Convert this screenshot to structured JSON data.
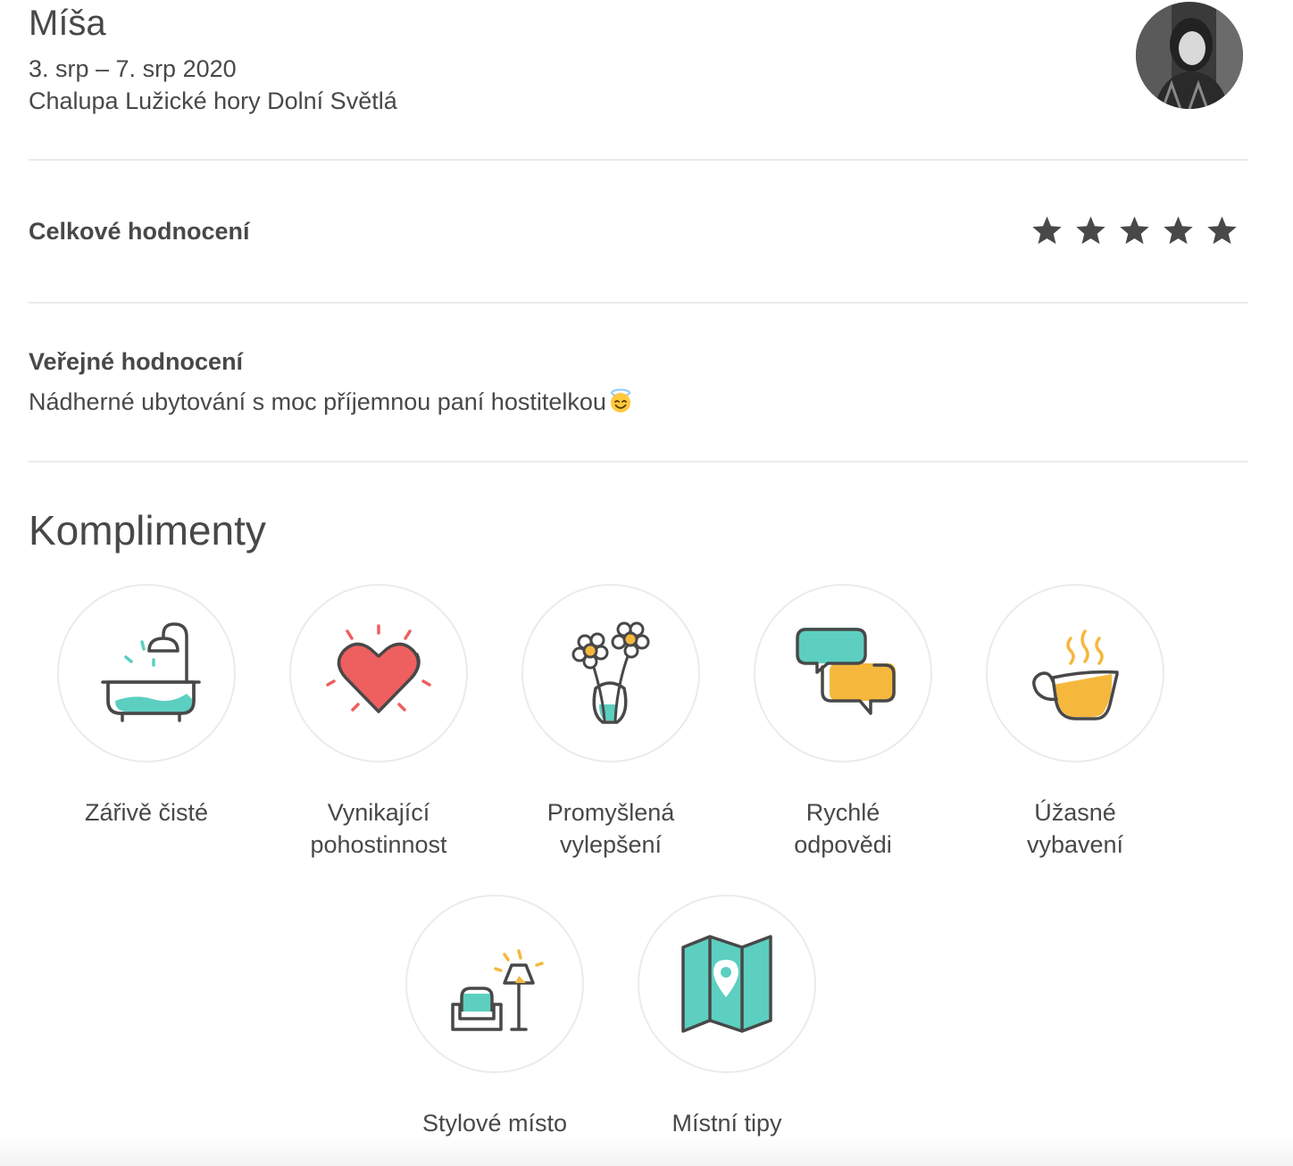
{
  "review": {
    "guest_name": "Míša",
    "dates": "3. srp – 7. srp 2020",
    "listing": "Chalupa Lužické hory Dolní Světlá"
  },
  "overall": {
    "label": "Celkové hodnocení",
    "stars": 5,
    "max_stars": 5,
    "star_color": "#484848"
  },
  "public_review": {
    "label": "Veřejné hodnocení",
    "text": "Nádherné ubytování s moc příjemnou paní hostitelkou",
    "emoji": "smiling-face-with-halo"
  },
  "compliments": {
    "title": "Komplimenty",
    "items": [
      {
        "line1": "Zářivě čisté",
        "line2": "",
        "icon": "bathtub-icon"
      },
      {
        "line1": "Vynikající",
        "line2": "pohostinnost",
        "icon": "heart-icon"
      },
      {
        "line1": "Promyšlená",
        "line2": "vylepšení",
        "icon": "flower-vase-icon"
      },
      {
        "line1": "Rychlé",
        "line2": "odpovědi",
        "icon": "chat-bubbles-icon"
      },
      {
        "line1": "Úžasné",
        "line2": "vybavení",
        "icon": "coffee-cup-icon"
      },
      {
        "line1": "Stylové místo",
        "line2": "",
        "icon": "armchair-lamp-icon"
      },
      {
        "line1": "Místní tipy",
        "line2": "",
        "icon": "map-pin-icon"
      }
    ]
  },
  "colors": {
    "text": "#484848",
    "teal": "#5ccfc0",
    "yellow": "#f5b83d",
    "red": "#ee5f5f",
    "divider": "#ebebeb"
  }
}
